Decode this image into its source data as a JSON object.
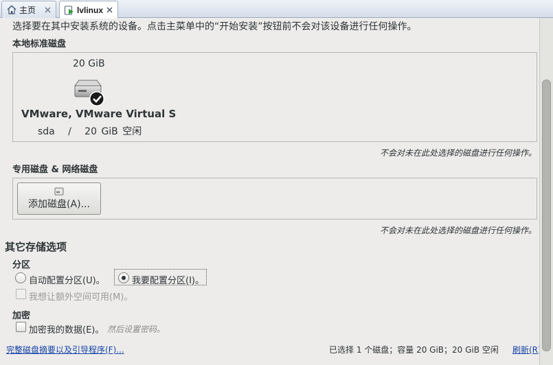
{
  "tabs": [
    {
      "label": "主页",
      "icon": "home-icon",
      "close_icon": "close-icon"
    },
    {
      "label": "lvlinux",
      "icon": "vm-icon",
      "close_icon": "close-icon"
    }
  ],
  "intro_text": "选择要在其中安装系统的设备。点击主菜单中的“开始安装”按钮前不会对该设备进行任何操作。",
  "local_disks": {
    "heading": "本地标准磁盘",
    "disk": {
      "size": "20 GiB",
      "name": "VMware, VMware Virtual S",
      "info": "sda   /   20 GiB 空闲",
      "icon": "hard-disk-selected-icon"
    },
    "note": "不会对未在此处选择的磁盘进行任何操作。"
  },
  "special_disks": {
    "heading": "专用磁盘 & 网络磁盘",
    "add_button_label": "添加磁盘(A)...",
    "note": "不会对未在此处选择的磁盘进行任何操作。"
  },
  "other_options": {
    "heading": "其它存储选项",
    "partition_heading": "分区",
    "auto_partition_label": "自动配置分区(U)。",
    "manual_partition_label": "我要配置分区(I)。",
    "extra_space_label": "我想让额外空间可用(M)。",
    "encryption_heading": "加密",
    "encrypt_label": "加密我的数据(E)。",
    "encrypt_hint": "然后设置密码。"
  },
  "footer": {
    "summary_link": "完整磁盘摘要以及引导程序(F)...",
    "status": "已选择 1 个磁盘；容量 20 GiB；20 GiB 空闲",
    "refresh_link": "刷新(R)"
  },
  "colors": {
    "link": "#1543a6",
    "background": "#edeceb"
  }
}
